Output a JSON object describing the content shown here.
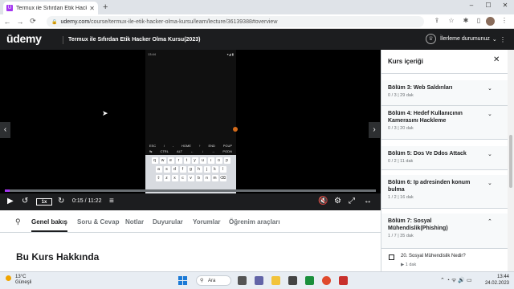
{
  "browser": {
    "tab_title": "Termux ile Sıfırdan Etik Hacker Ol",
    "url_domain": "udemy.com",
    "url_path": "/course/termux-ile-etik-hacker-olma-kursu/learn/lecture/36139388#overview"
  },
  "header": {
    "logo": "ūdemy",
    "course_title": "Termux ile Sıfırdan Etik Hacker Olma Kursu(2023)",
    "progress_label": "İlerleme durumunuz"
  },
  "player": {
    "playback_rate": "1x",
    "time": "0:15 / 11:22",
    "progress_fraction": 0.013,
    "phone_status_left": "13:44",
    "phone_status_right": "▾◢ ▮",
    "extra_keys_row1": [
      "ESC",
      "/",
      "-",
      "HOME",
      "↑",
      "END",
      "PGUP"
    ],
    "extra_keys_row2": [
      "↹",
      "CTRL",
      "ALT",
      "←",
      "↓",
      "→",
      "PGDN"
    ],
    "keyboard_row1": [
      "q",
      "w",
      "e",
      "r",
      "t",
      "y",
      "u",
      "ı",
      "o",
      "p"
    ],
    "keyboard_row2": [
      "a",
      "s",
      "d",
      "f",
      "g",
      "h",
      "j",
      "k",
      "l"
    ],
    "keyboard_row3": [
      "⇧",
      "z",
      "x",
      "c",
      "v",
      "b",
      "n",
      "m",
      "⌫"
    ]
  },
  "tabs": [
    "Genel bakış",
    "Soru & Cevap",
    "Notlar",
    "Duyurular",
    "Yorumlar",
    "Öğrenim araçları"
  ],
  "about_heading": "Bu Kurs Hakkında",
  "sidebar": {
    "heading": "Kurs içeriği",
    "sections": [
      {
        "title": "Bölüm 3: Web Saldırıları",
        "meta": "0 / 3 | 29 dak"
      },
      {
        "title": "Bölüm 4: Hedef Kullanıcının Kamerasını Hackleme",
        "meta": "0 / 3 | 20 dak"
      },
      {
        "title": "Bölüm 5: Dos Ve Ddos Attack",
        "meta": "0 / 2 | 11 dak"
      },
      {
        "title": "Bölüm 6: Ip adresinden konum bulma",
        "meta": "1 / 2 | 16 dak"
      },
      {
        "title": "Bölüm 7: Sosyal Mühendislik(Phishing)",
        "meta": "1 / 7 | 35 dak"
      }
    ],
    "lesson": {
      "title": "20. Sosyal Mühendislik Nedir?",
      "duration": "1 dak"
    }
  },
  "taskbar": {
    "temp": "13°C",
    "weather": "Güneşli",
    "search": "Ara",
    "time": "13:44",
    "date": "24.02.2023"
  },
  "colors": {
    "brand": "#a435f0",
    "dark": "#1c1d1f"
  }
}
